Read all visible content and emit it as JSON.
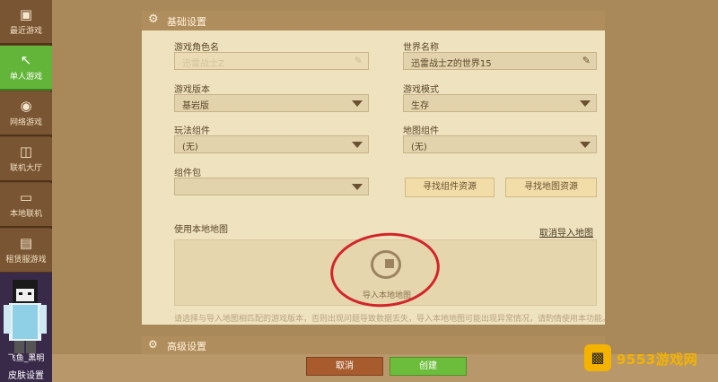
{
  "sidebar": {
    "items": [
      {
        "label": "最近游戏",
        "icon": "gamepad-icon"
      },
      {
        "label": "单人游戏",
        "icon": "pickaxe-icon"
      },
      {
        "label": "网络游戏",
        "icon": "globe-icon"
      },
      {
        "label": "联机大厅",
        "icon": "monitors-icon"
      },
      {
        "label": "本地联机",
        "icon": "monitor-icon"
      },
      {
        "label": "租赁服游戏",
        "icon": "server-list-icon"
      }
    ],
    "avatar_name": "飞鱼_黑明",
    "skin_label": "皮肤设置"
  },
  "basic": {
    "title": "基础设置",
    "role_name_label": "游戏角色名",
    "role_name_value": "迅雷战士Z",
    "world_name_label": "世界名称",
    "world_name_value": "迅雷战士Z的世界15",
    "version_label": "游戏版本",
    "version_value": "基岩版",
    "mode_label": "游戏模式",
    "mode_value": "生存",
    "play_comp_label": "玩法组件",
    "play_comp_value": "(无)",
    "map_comp_label": "地图组件",
    "map_comp_value": "(无)",
    "pack_label": "组件包",
    "find_comp_button": "寻找组件资源",
    "find_map_button": "寻找地图资源",
    "local_map_label": "使用本地地图",
    "cancel_import_link": "取消导入地图",
    "import_label": "导入本地地图",
    "hint": "请选择与导入地图相匹配的游戏版本，否则出现问题导致数据丢失，导入本地地图可能出现异常情况，请酌情使用本功能。"
  },
  "advanced": {
    "title": "高级设置"
  },
  "footer": {
    "cancel": "取消",
    "create": "创建"
  },
  "watermark": {
    "text": "9553游戏网"
  },
  "colors": {
    "active": "#63b53a",
    "create": "#6dbd3d",
    "cancel": "#a85c2e",
    "annotation": "#d2252b"
  }
}
